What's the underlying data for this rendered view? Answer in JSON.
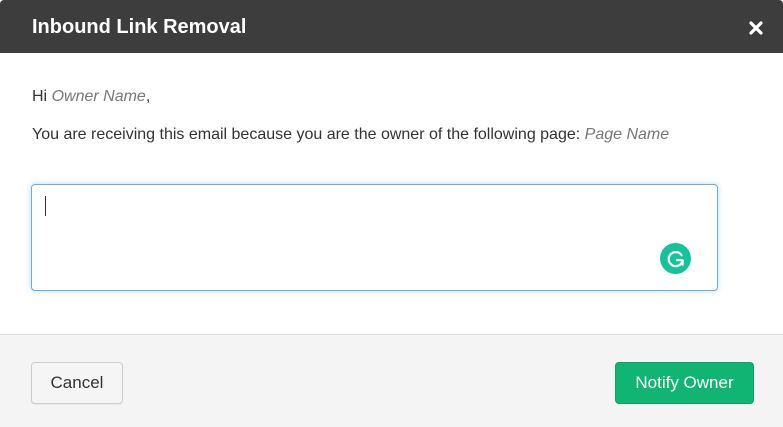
{
  "dialog": {
    "title": "Inbound Link Removal",
    "close_icon": "close-icon"
  },
  "body": {
    "greeting_prefix": "Hi ",
    "owner_name": "Owner Name",
    "greeting_suffix": ",",
    "message_text": "You are receiving this email because you are the owner of the following page: ",
    "page_name": "Page Name",
    "message_input_value": "",
    "grammarly_icon": "grammarly-icon"
  },
  "footer": {
    "cancel_label": "Cancel",
    "notify_label": "Notify Owner"
  },
  "colors": {
    "header_bg": "#3d3d3d",
    "primary_button": "#10b574",
    "focus_border": "#66afe9",
    "grammarly": "#15c39a"
  }
}
